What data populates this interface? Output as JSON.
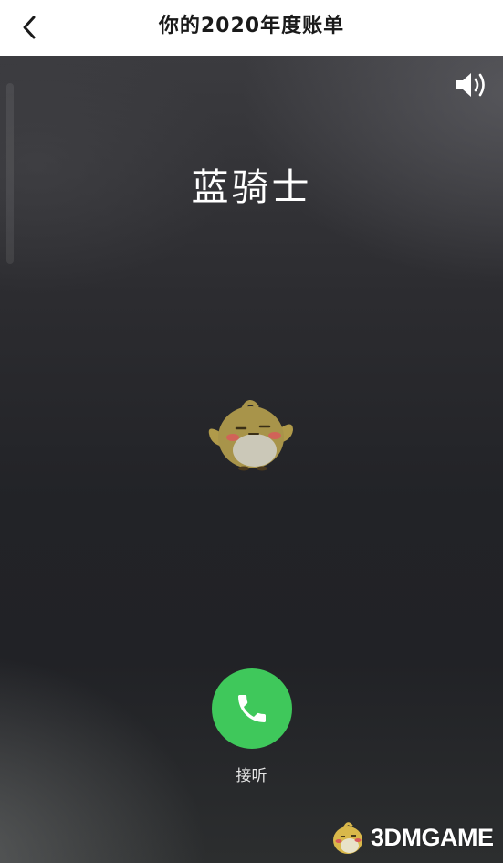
{
  "header": {
    "title": "你的2020年度账单",
    "back_icon": "chevron-left-icon"
  },
  "call": {
    "caller_name": "蓝骑士",
    "speaker_icon": "speaker-icon",
    "answer_icon": "phone-icon",
    "answer_label": "接听",
    "answer_color": "#3fc85b"
  },
  "watermark": {
    "text": "3DMGAME"
  }
}
